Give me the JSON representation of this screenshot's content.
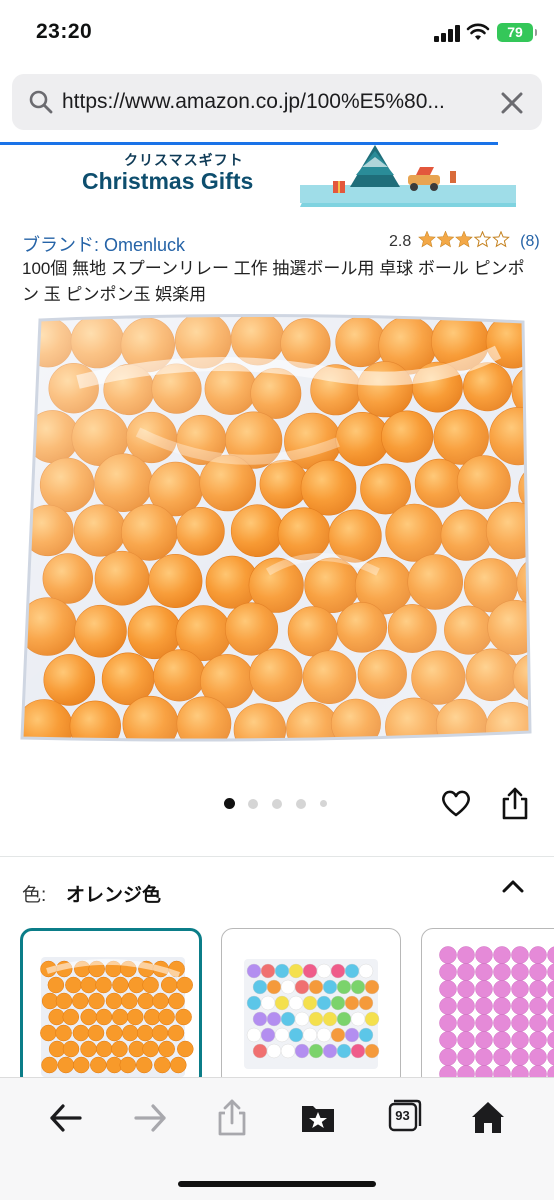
{
  "status_bar": {
    "time": "23:20",
    "battery": "79",
    "icons": [
      "signal-icon",
      "wifi-icon",
      "battery-icon"
    ]
  },
  "browser": {
    "url": "https://www.amazon.co.jp/100%E5%80...",
    "icons": [
      "search-icon",
      "close-icon"
    ]
  },
  "banner": {
    "subtitle": "クリスマスギフト",
    "title": "Christmas Gifts"
  },
  "product": {
    "brand": "ブランド: Omenluck",
    "rating": "2.8",
    "rating_fraction": 0.56,
    "review_count": "(8)",
    "title": "100個 無地 スプーンリレー 工作 抽選ボール用 卓球 ボール ピンポン 玉 ピンポン玉 娯楽用",
    "image_count": 5,
    "active_image_index": 0
  },
  "variation": {
    "label": "色:",
    "selected_value": "オレンジ色",
    "swatches": [
      "orange",
      "mixed-colors",
      "pink"
    ]
  },
  "colors": {
    "accent_teal": "#0b7d88",
    "link_blue": "#2563a7",
    "star_orange": "#f3a847",
    "ball_orange": "#f89a2a"
  },
  "toolbar": {
    "tabs_count": "93",
    "icons": [
      "back-arrow-icon",
      "forward-arrow-icon",
      "share-icon",
      "bookmarks-icon",
      "tabs-icon",
      "home-icon"
    ]
  }
}
